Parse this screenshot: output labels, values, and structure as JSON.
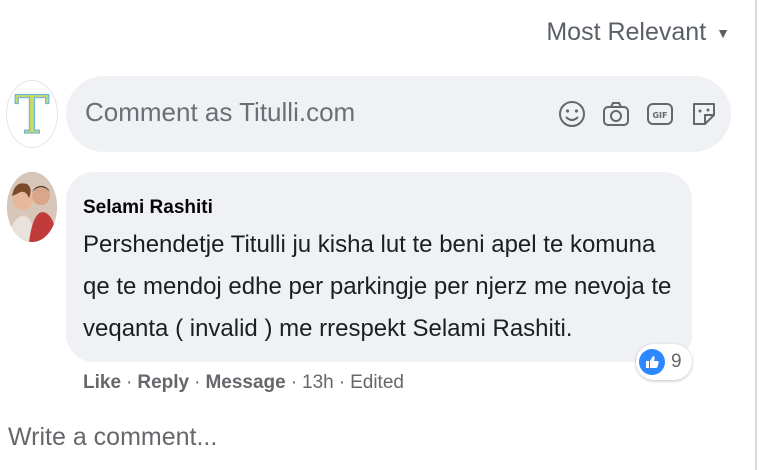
{
  "sort": {
    "label": "Most Relevant",
    "icon": "caret-down-icon"
  },
  "composer": {
    "placeholder": "Comment as Titulli.com",
    "avatar_letter": "T",
    "icons": [
      "emoji-icon",
      "camera-icon",
      "gif-icon",
      "sticker-icon"
    ],
    "icon_gif_text": "GIF"
  },
  "comment": {
    "author": "Selami Rashiti",
    "text": "Pershendetje Titulli ju kisha lut te beni apel te komuna qe te mendoj edhe per parkingje per njerz me nevoja te veqanta ( invalid ) me rrespekt Selami Rashiti.",
    "reaction": {
      "icon": "like-icon",
      "count": "9",
      "color": "#2d88ff"
    },
    "actions": {
      "like": "Like",
      "reply": "Reply",
      "message": "Message",
      "time": "13h",
      "edited": "Edited",
      "separator": "·"
    }
  },
  "write_comment": {
    "placeholder": "Write a comment..."
  }
}
